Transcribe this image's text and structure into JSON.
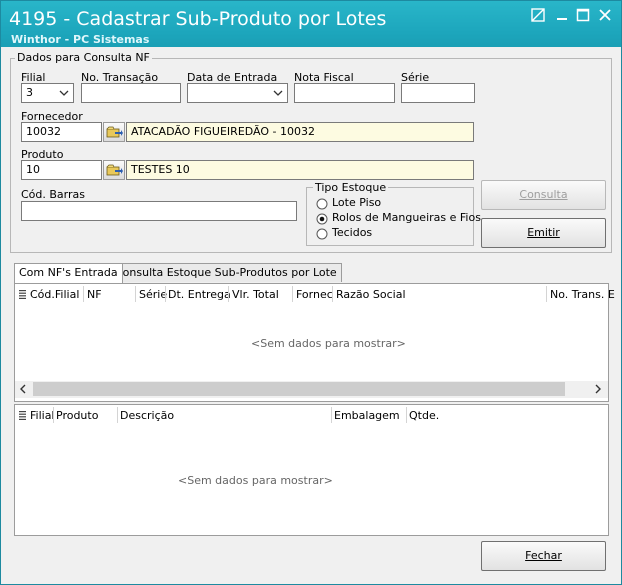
{
  "window": {
    "title": "4195 - Cadastrar Sub-Produto por Lotes",
    "subtitle": "Winthor - PC Sistemas"
  },
  "group": {
    "legend": "Dados para Consulta NF",
    "filial": {
      "label": "Filial",
      "value": "3"
    },
    "transacao": {
      "label": "No. Transação",
      "value": ""
    },
    "data_entrada": {
      "label": "Data de Entrada",
      "value": ""
    },
    "nota_fiscal": {
      "label": "Nota Fiscal",
      "value": ""
    },
    "serie": {
      "label": "Série",
      "value": ""
    },
    "fornecedor": {
      "label": "Fornecedor",
      "code": "10032",
      "name": "ATACADÃO FIGUEIREDÃO - 10032"
    },
    "produto": {
      "label": "Produto",
      "code": "10",
      "name": "TESTES 10"
    },
    "cod_barras": {
      "label": "Cód. Barras",
      "value": ""
    },
    "tipo_estoque": {
      "legend": "Tipo Estoque",
      "options": [
        "Lote Piso",
        "Rolos de Mangueiras e Fios",
        "Tecidos"
      ],
      "selected_index": 1
    }
  },
  "buttons": {
    "consulta": {
      "label": "Consulta",
      "enabled": false
    },
    "emitir": {
      "label": "Emitir"
    },
    "fechar": {
      "label": "Fechar"
    }
  },
  "tabs": [
    {
      "label": "Com NF's Entrada"
    },
    {
      "label": "Consulta Estoque Sub-Produtos por Lote"
    }
  ],
  "grid_nf": {
    "columns": [
      "Cód.Filial",
      "NF",
      "Série",
      "Dt. Entrega",
      "Vlr. Total",
      "Fornec",
      "Razão Social",
      "No. Trans. E"
    ],
    "empty_text": "<Sem dados para mostrar>"
  },
  "grid_produtos": {
    "columns": [
      "Filial",
      "Produto",
      "Descrição",
      "Embalagem",
      "Qtde."
    ],
    "empty_text": "<Sem dados para mostrar>"
  }
}
